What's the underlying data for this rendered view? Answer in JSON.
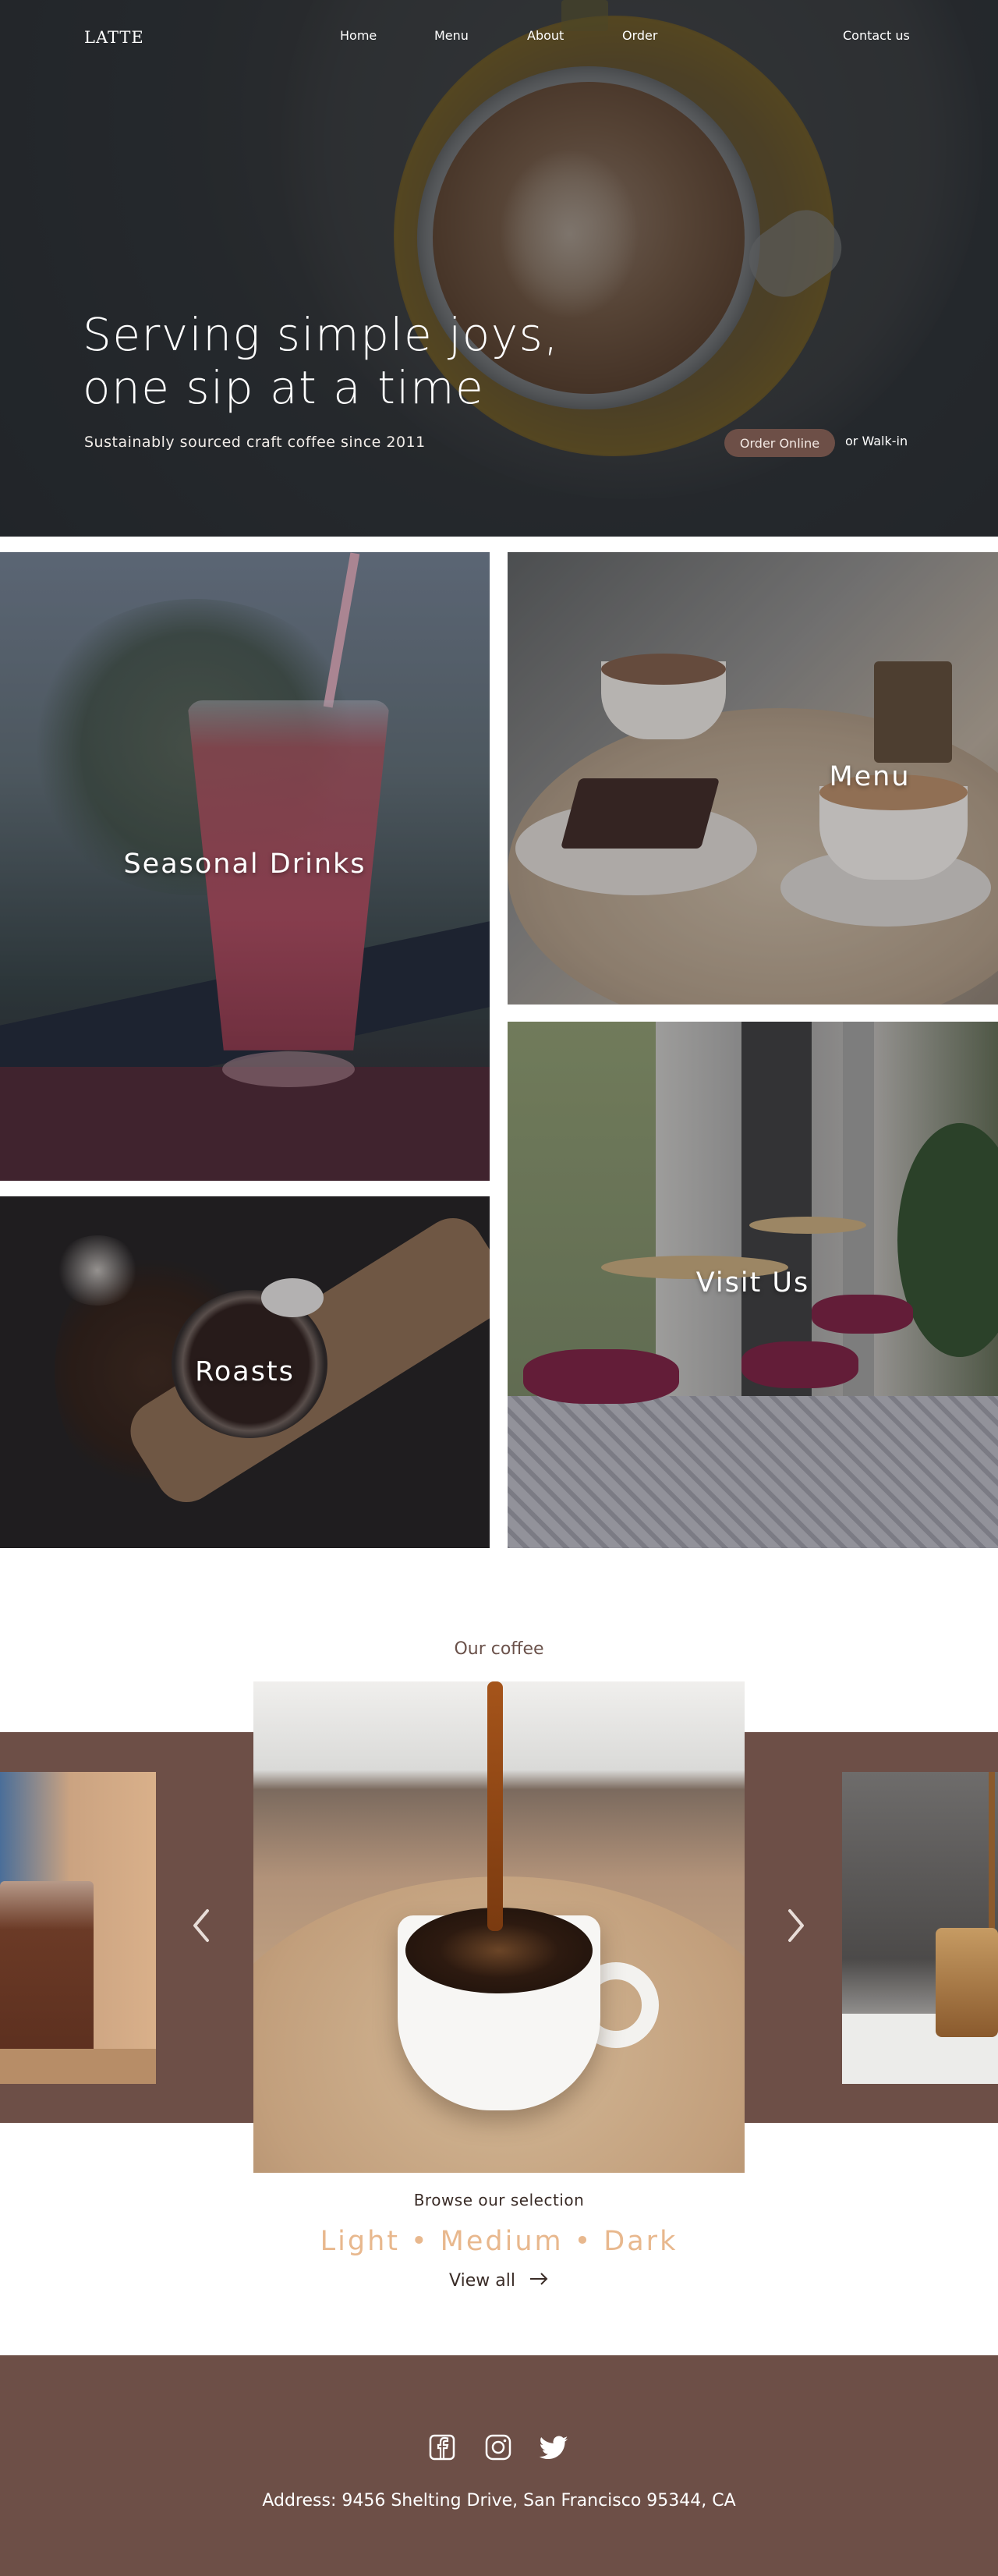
{
  "nav": {
    "logo": "LATTE",
    "links": [
      "Home",
      "Menu",
      "About",
      "Order"
    ],
    "contact": "Contact us"
  },
  "hero": {
    "title_line1": "Serving simple joys,",
    "title_line2": "one sip at a time",
    "subtitle": "Sustainably sourced craft coffee since 2011",
    "order_button": "Order Online",
    "walkin": "or Walk-in"
  },
  "gallery": {
    "seasonal": "Seasonal Drinks",
    "menu": "Menu",
    "visit": "Visit Us",
    "roasts": "Roasts"
  },
  "coffee": {
    "heading": "Our coffee",
    "browse": "Browse our selection",
    "roast_levels": [
      "Light",
      "Medium",
      "Dark"
    ],
    "separator": "•",
    "view_all": "View all"
  },
  "footer": {
    "social": [
      "facebook-icon",
      "instagram-icon",
      "twitter-icon"
    ],
    "address": "Address: 9456 Shelting Drive, San Francisco 95344, CA"
  },
  "colors": {
    "brand_brown": "#6d4f47",
    "accent_peach": "#e8b88e",
    "text_dark": "#3a2c27"
  }
}
